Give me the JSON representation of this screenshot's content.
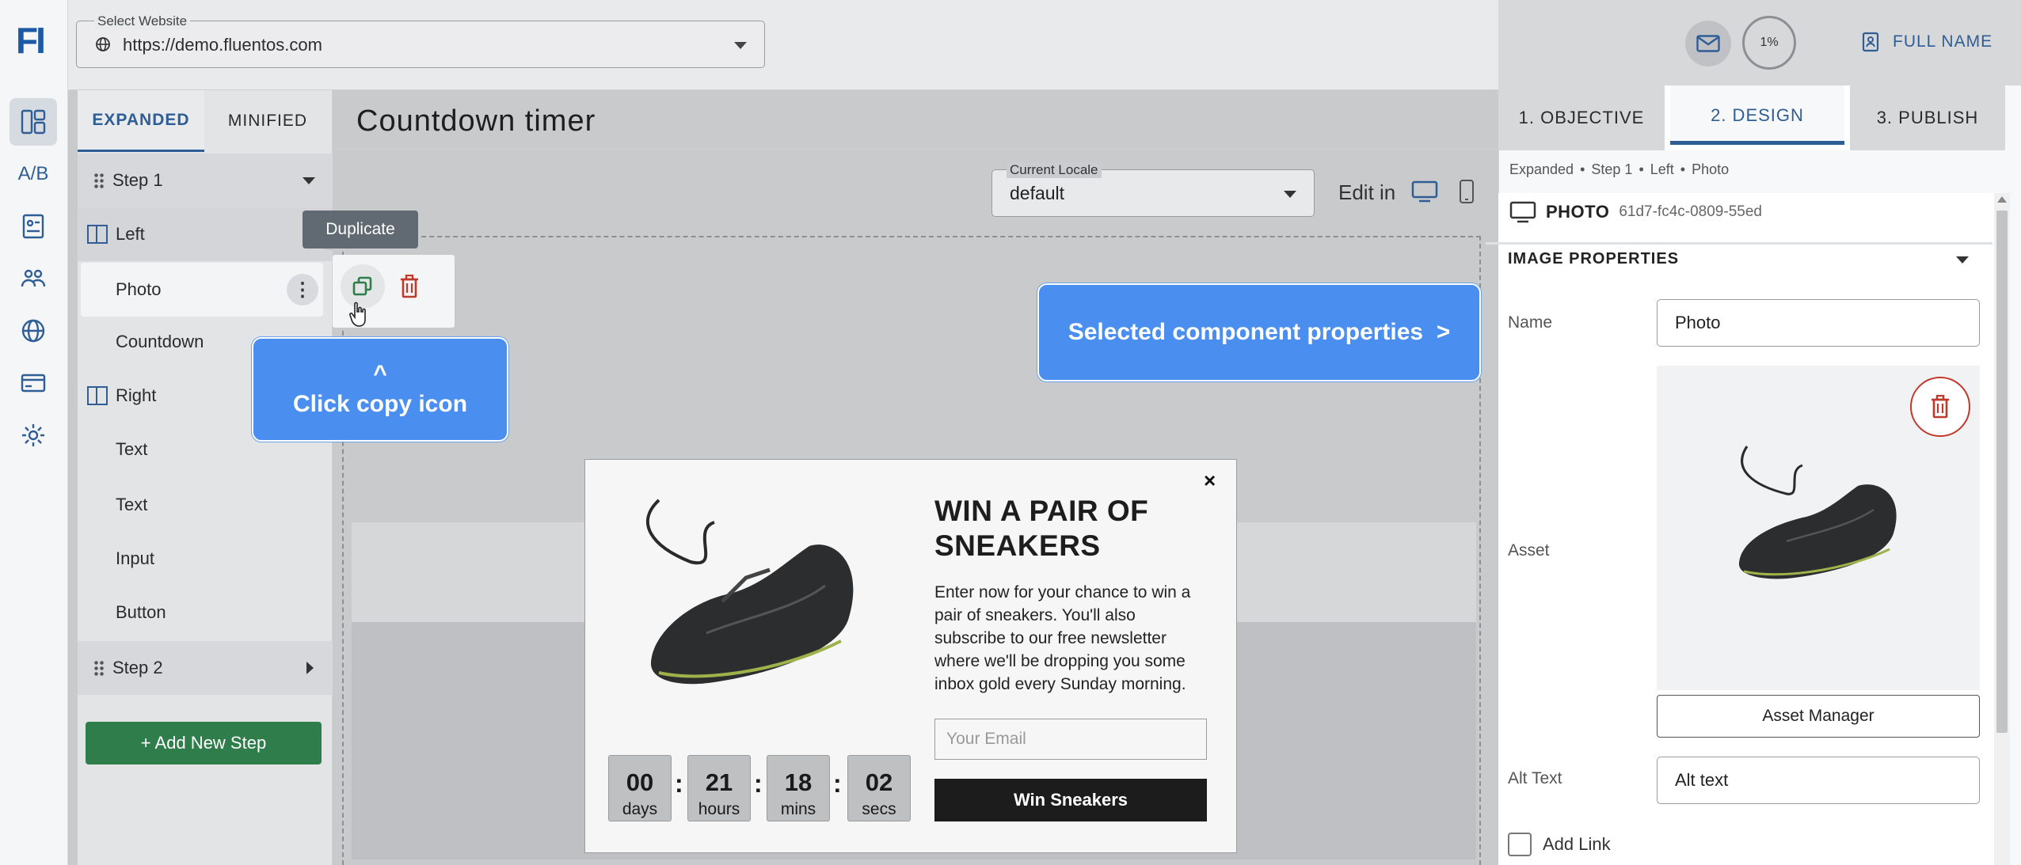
{
  "app": {
    "logo": "FI",
    "rail": [
      "dashboard-icon",
      "ab-test-icon",
      "forms-icon",
      "audience-icon",
      "websites-icon",
      "billing-icon",
      "settings-icon"
    ],
    "ab_label": "A/B"
  },
  "website_select": {
    "label": "Select Website",
    "value": "https://demo.fluentos.com"
  },
  "tree": {
    "tabs": [
      "EXPANDED",
      "MINIFIED"
    ],
    "step1": "Step 1",
    "left": "Left",
    "photo": "Photo",
    "countdown": "Countdown",
    "right": "Right",
    "text1": "Text",
    "text2": "Text",
    "input": "Input",
    "button": "Button",
    "step2": "Step 2",
    "add_step": "+ Add New Step"
  },
  "canvas": {
    "title": "Countdown timer",
    "locale_label": "Current Locale",
    "locale_value": "default",
    "edit_in": "Edit in"
  },
  "tooltip": "Duplicate",
  "callouts": {
    "copy_caret": "^",
    "copy_text": "Click copy icon",
    "props_text": "Selected component properties  >"
  },
  "popup": {
    "close": "×",
    "heading": "WIN A PAIR OF SNEAKERS",
    "body": "Enter now for your chance to win a pair of sneakers. You'll also subscribe to our free newsletter where we'll be dropping you some inbox gold every Sunday morning.",
    "email_placeholder": "Your Email",
    "button": "Win Sneakers",
    "countdown": [
      {
        "num": "00",
        "unit": "days"
      },
      {
        "num": "21",
        "unit": "hours"
      },
      {
        "num": "18",
        "unit": "mins"
      },
      {
        "num": "02",
        "unit": "secs"
      }
    ],
    "sep": ":"
  },
  "header_right": {
    "progress": "1%",
    "full_name": "FULL NAME"
  },
  "steps_tabs": [
    "1. OBJECTIVE",
    "2. DESIGN",
    "3. PUBLISH"
  ],
  "breadcrumb": [
    "Expanded",
    "Step 1",
    "Left",
    "Photo"
  ],
  "breadcrumb_sep": "•",
  "component": {
    "type": "PHOTO",
    "id": "61d7-fc4c-0809-55ed",
    "section": "IMAGE PROPERTIES",
    "name_label": "Name",
    "name_value": "Photo",
    "asset_label": "Asset",
    "asset_manager": "Asset Manager",
    "alt_label": "Alt Text",
    "alt_value": "Alt text",
    "add_link": "Add Link"
  },
  "colors": {
    "brand": "#2f5d95",
    "callout": "#4a8ef0",
    "add_step": "#2e7d4a",
    "danger": "#c0392b"
  }
}
